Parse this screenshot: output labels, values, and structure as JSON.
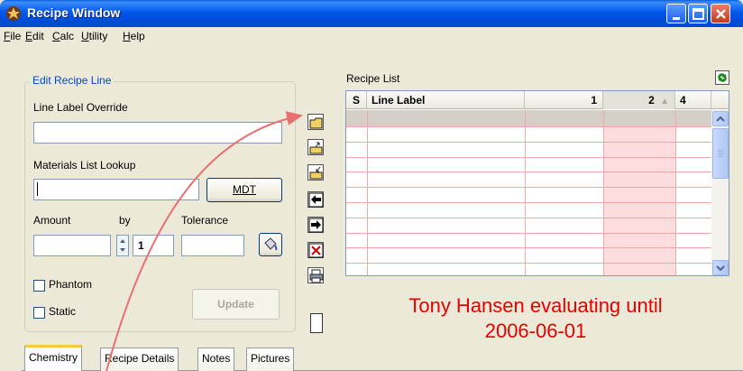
{
  "window": {
    "title": "Recipe Window",
    "app_icon": "leaf-icon"
  },
  "menu": [
    {
      "label": "File",
      "mnemonic": "F"
    },
    {
      "label": "Edit",
      "mnemonic": "E"
    },
    {
      "label": "Calc",
      "mnemonic": "C"
    },
    {
      "label": "Utility",
      "mnemonic": "U"
    },
    {
      "label": "Help",
      "mnemonic": "H"
    }
  ],
  "edit_group": {
    "legend": "Edit Recipe Line",
    "line_label_override": {
      "label": "Line Label Override",
      "value": ""
    },
    "materials_lookup": {
      "label": "Materials List Lookup",
      "value": "",
      "button": "MDT"
    },
    "amount": {
      "label": "Amount",
      "value": ""
    },
    "by": {
      "label": "by",
      "value": "1"
    },
    "tolerance": {
      "label": "Tolerance",
      "value": ""
    },
    "phantom": {
      "label": "Phantom",
      "checked": false
    },
    "static": {
      "label": "Static",
      "checked": false
    },
    "update_button": "Update"
  },
  "toolbar": [
    "open-folder-icon",
    "export-icon",
    "import-icon",
    "move-left-icon",
    "move-right-icon",
    "delete-icon",
    "print-icon"
  ],
  "recipe_list": {
    "title": "Recipe List",
    "columns": {
      "s": "S",
      "line_label": "Line Label",
      "c1": "1",
      "c2": "2",
      "c4": "4"
    },
    "sort_indicator": "▲",
    "rows": 11
  },
  "eval_message": {
    "line1": "Tony Hansen evaluating until",
    "line2": "2006-06-01"
  },
  "tabs": [
    "Chemistry",
    "Recipe Details",
    "Notes",
    "Pictures"
  ],
  "colors": {
    "accent": "#0058ee",
    "eval_text": "#e60000",
    "grid_highlight": "#fcdcdc",
    "tab_active": "#ffc83c"
  }
}
